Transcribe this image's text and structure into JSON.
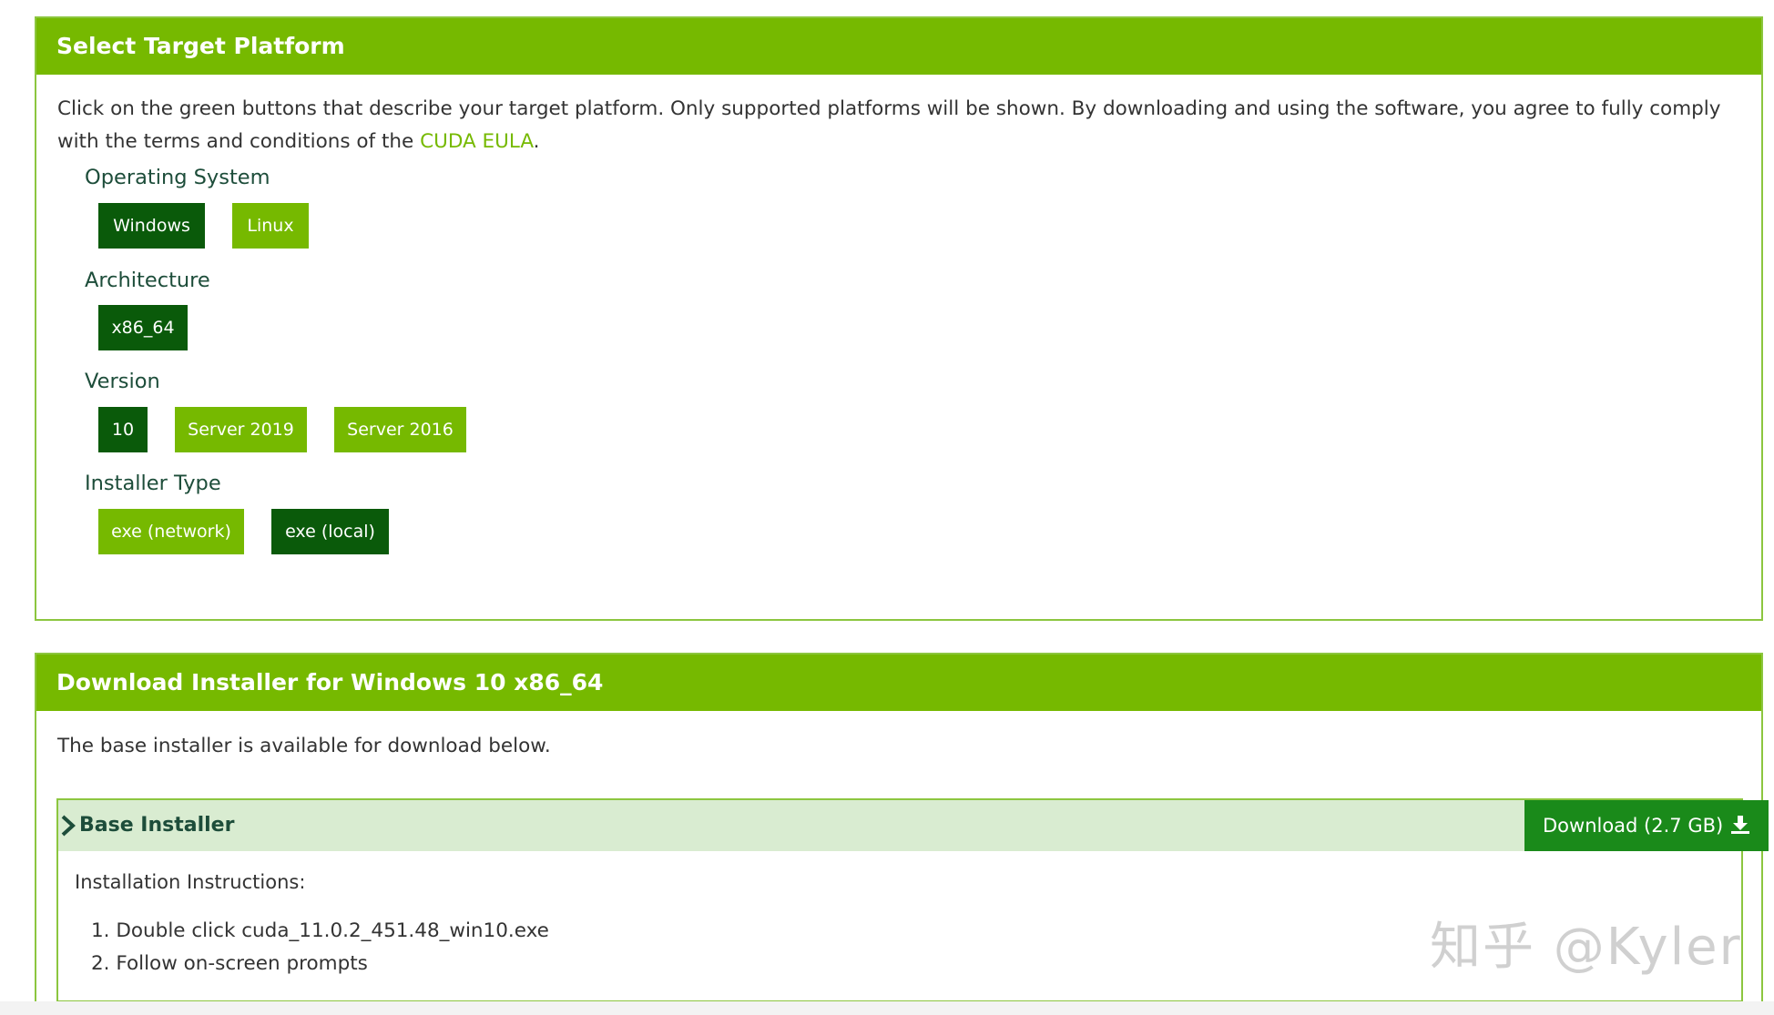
{
  "platform_panel": {
    "title": "Select Target Platform",
    "intro_text": "Click on the green buttons that describe your target platform. Only supported platforms will be shown. By downloading and using the software, you agree to fully comply with the terms and conditions of the ",
    "eula_link": "CUDA EULA",
    "intro_end": ".",
    "os": {
      "label": "Operating System",
      "options": [
        {
          "label": "Windows",
          "state": "selected"
        },
        {
          "label": "Linux",
          "state": "available"
        }
      ]
    },
    "architecture": {
      "label": "Architecture",
      "options": [
        {
          "label": "x86_64",
          "state": "selected"
        }
      ]
    },
    "version": {
      "label": "Version",
      "options": [
        {
          "label": "10",
          "state": "selected"
        },
        {
          "label": "Server 2019",
          "state": "available"
        },
        {
          "label": "Server 2016",
          "state": "available"
        }
      ]
    },
    "installer_type": {
      "label": "Installer Type",
      "options": [
        {
          "label": "exe (network)",
          "state": "available"
        },
        {
          "label": "exe (local)",
          "state": "selected"
        }
      ]
    }
  },
  "download_panel": {
    "title": "Download Installer for Windows 10 x86_64",
    "description": "The base installer is available for download below.",
    "base_installer": {
      "title": "Base Installer",
      "download_label": "Download (2.7 GB)",
      "instructions_heading": "Installation Instructions:",
      "steps": [
        "1. Double click cuda_11.0.2_451.48_win10.exe",
        "2. Follow on-screen prompts"
      ]
    }
  },
  "watermark": "知乎 @Kyler",
  "colors": {
    "brand_green": "#76b900",
    "selected_green": "#0a5a0a",
    "download_green": "#1a8a1a",
    "installer_bar": "#d9ecd1"
  }
}
